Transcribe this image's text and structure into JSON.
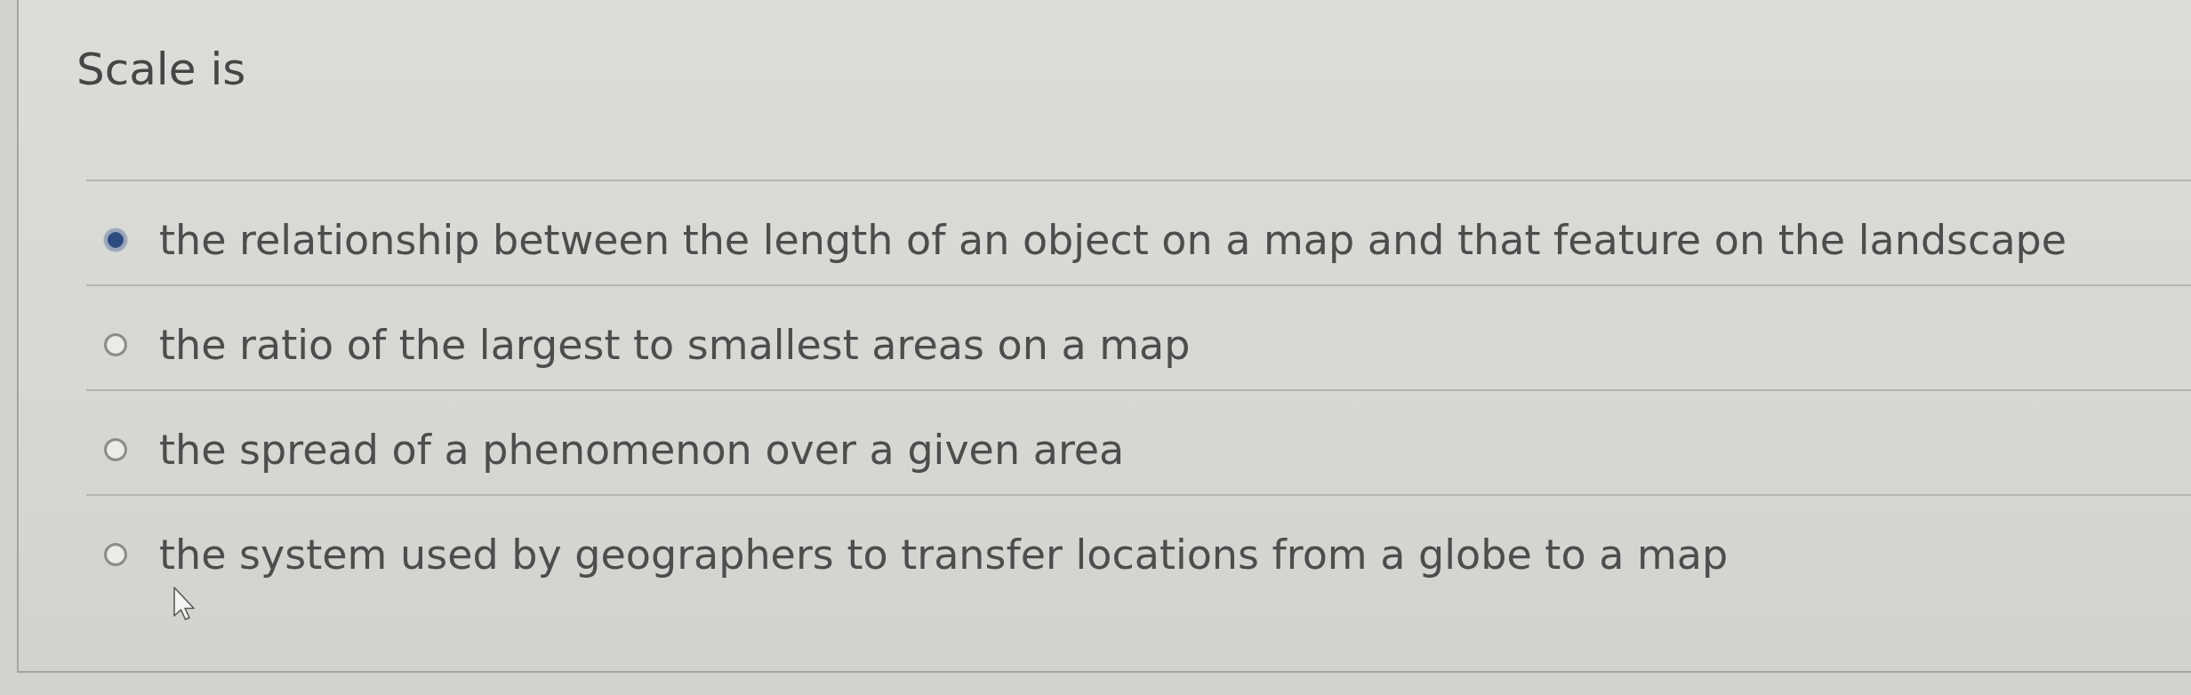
{
  "question": {
    "text": "Scale is"
  },
  "options": [
    {
      "label": "the relationship between the length of an object on a map and that feature on the landscape",
      "selected": true
    },
    {
      "label": "the ratio of the largest to smallest areas on a map",
      "selected": false
    },
    {
      "label": "the spread of a phenomenon over a given area",
      "selected": false
    },
    {
      "label": "the system used by geographers to transfer locations from a globe to a map",
      "selected": false
    }
  ]
}
